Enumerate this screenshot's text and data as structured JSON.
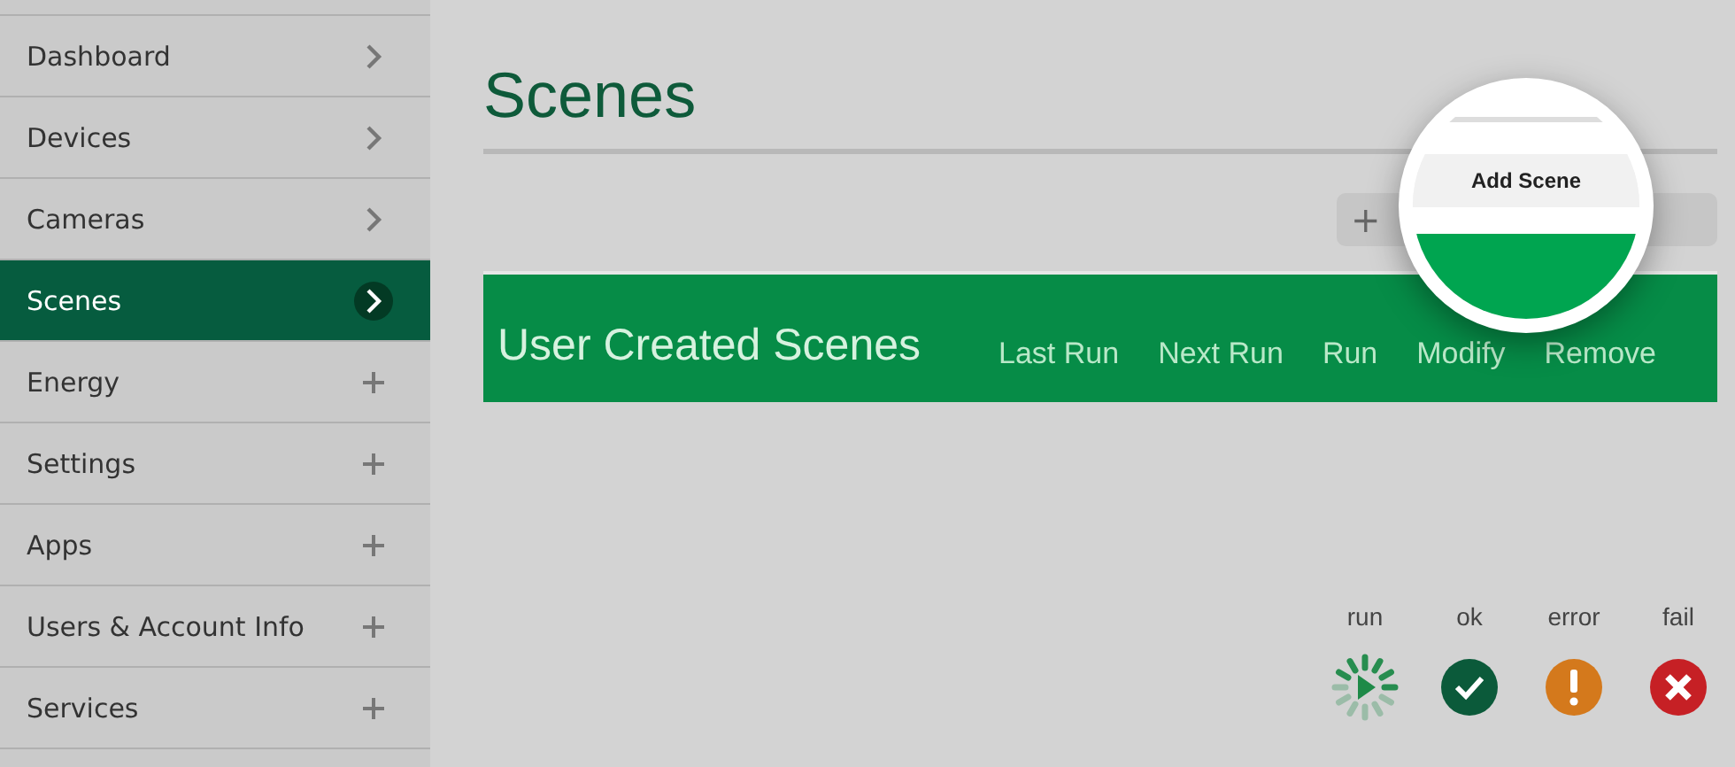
{
  "sidebar": {
    "items": [
      {
        "label": "Dashboard",
        "kind": "chevron",
        "selected": false
      },
      {
        "label": "Devices",
        "kind": "chevron",
        "selected": false
      },
      {
        "label": "Cameras",
        "kind": "chevron",
        "selected": false
      },
      {
        "label": "Scenes",
        "kind": "chevron",
        "selected": true
      },
      {
        "label": "Energy",
        "kind": "plus",
        "selected": false
      },
      {
        "label": "Settings",
        "kind": "plus",
        "selected": false
      },
      {
        "label": "Apps",
        "kind": "plus",
        "selected": false
      },
      {
        "label": "Users & Account Info",
        "kind": "plus",
        "selected": false
      },
      {
        "label": "Services",
        "kind": "plus",
        "selected": false
      }
    ]
  },
  "page": {
    "title": "Scenes"
  },
  "toolbar": {
    "add_icon": "+",
    "add_button": "Add Scene"
  },
  "table": {
    "title": "User Created Scenes",
    "columns": [
      "Last Run",
      "Next Run",
      "Run",
      "Modify",
      "Remove"
    ]
  },
  "legend": [
    {
      "label": "run",
      "kind": "run"
    },
    {
      "label": "ok",
      "kind": "ok"
    },
    {
      "label": "error",
      "kind": "error"
    },
    {
      "label": "fail",
      "kind": "fail"
    }
  ]
}
